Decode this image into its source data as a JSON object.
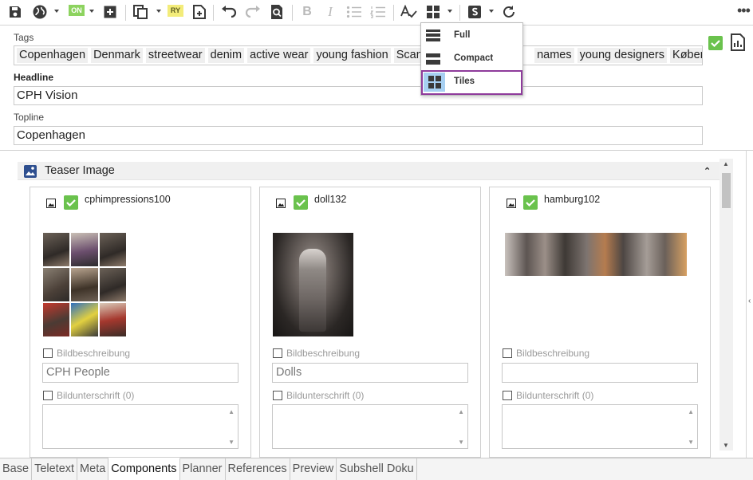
{
  "toolbar": {
    "buttons": [
      "save-icon",
      "globe-icon",
      "on-status",
      "add-box-icon",
      "copy-icon",
      "ry-status",
      "add-page-icon",
      "undo-icon",
      "redo-icon",
      "find-icon",
      "bold-icon",
      "italic-icon",
      "bullet-list-icon",
      "numbered-list-icon",
      "spellcheck-icon",
      "view-layout-icon",
      "s-badge-icon",
      "refresh-icon",
      "more-icon"
    ],
    "on_label": "ON",
    "ry_label": "RY",
    "more_label": "•••"
  },
  "view_menu": {
    "items": [
      {
        "label": "Full",
        "icon": "full-view-icon"
      },
      {
        "label": "Compact",
        "icon": "compact-view-icon"
      },
      {
        "label": "Tiles",
        "icon": "tiles-view-icon",
        "selected": true
      }
    ]
  },
  "form": {
    "tags_label": "Tags",
    "tags": [
      "Copenhagen",
      "Denmark",
      "streetwear",
      "denim",
      "active wear",
      "young fashion",
      "Scandi",
      "names",
      "young designers",
      "Københav"
    ],
    "headline_label": "Headline",
    "headline_value": "CPH Vision",
    "topline_label": "Topline",
    "topline_value": "Copenhagen"
  },
  "teaser": {
    "title": "Teaser Image",
    "cards": [
      {
        "name": "cphimpressions100",
        "desc_label": "Bildbeschreibung",
        "desc_value": "CPH People",
        "caption_label": "Bildunterschrift (0)"
      },
      {
        "name": "doll132",
        "desc_label": "Bildbeschreibung",
        "desc_value": "Dolls",
        "caption_label": "Bildunterschrift (0)"
      },
      {
        "name": "hamburg102",
        "desc_label": "Bildbeschreibung",
        "desc_value": "",
        "caption_label": "Bildunterschrift (0)"
      }
    ]
  },
  "tabs": [
    "Base",
    "Teletext",
    "Meta",
    "Components",
    "Planner",
    "References",
    "Preview",
    "Subshell Doku"
  ],
  "active_tab": "Components",
  "colors": {
    "accent_green": "#6ac24d",
    "selection_purple": "#8e3b9b",
    "tile_highlight": "#a7d0f2"
  }
}
